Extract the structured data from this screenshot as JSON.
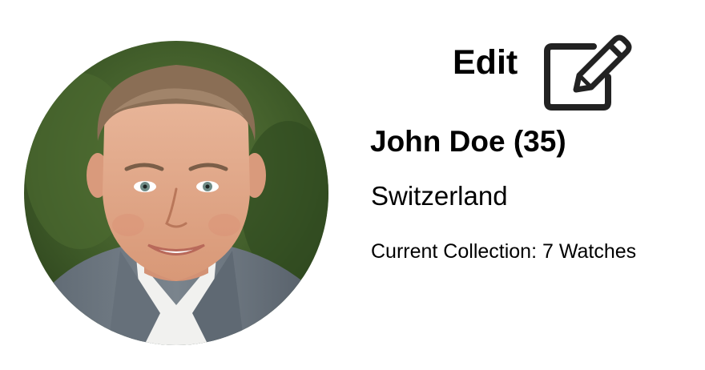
{
  "profile": {
    "avatar_icon": "user-photo",
    "edit_label": "Edit",
    "edit_icon": "pencil-square-icon",
    "name_line": "John Doe (35)",
    "country": "Switzerland",
    "collection_line": "Current Collection: 7 Watches"
  }
}
